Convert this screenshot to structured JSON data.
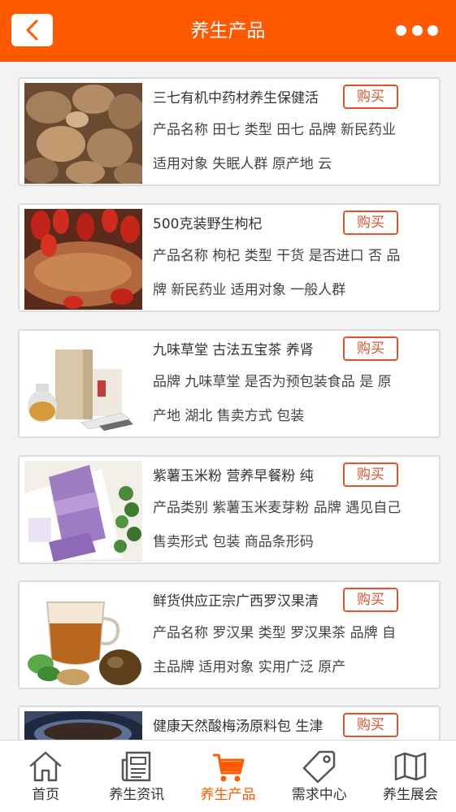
{
  "header": {
    "title": "养生产品"
  },
  "products": [
    {
      "name": "三七有机中药材养生保健活",
      "buy_label": "购买",
      "desc": "产品名称 田七 类型 田七 品牌 新民药业 适用对象 失眠人群 原产地 云",
      "image": "sanqi-root-photo"
    },
    {
      "name": "500克装野生枸杞",
      "buy_label": "购买",
      "desc": "产品名称 枸杞 类型 干货 是否进口 否 品牌 新民药业 适用对象 一般人群",
      "image": "goji-berry-photo"
    },
    {
      "name": "九味草堂 古法五宝茶 养肾",
      "buy_label": "购买",
      "desc": "品牌 九味草堂 是否为预包装食品 是 原产地 湖北 售卖方式 包装",
      "image": "tea-box-photo"
    },
    {
      "name": "紫薯玉米粉 营养早餐粉 纯",
      "buy_label": "购买",
      "desc": "产品类别 紫薯玉米麦芽粉 品牌 遇见自己 售卖形式 包装 商品条形码",
      "image": "purple-powder-package-photo"
    },
    {
      "name": "鲜货供应正宗广西罗汉果清",
      "buy_label": "购买",
      "desc": "产品名称 罗汉果 类型 罗汉果茶 品牌 自主品牌 适用对象 实用广泛 原产",
      "image": "luohan-tea-photo"
    },
    {
      "name": "健康天然酸梅汤原料包 生津",
      "buy_label": "购买",
      "desc": "",
      "image": "plum-soup-photo"
    }
  ],
  "tabbar": [
    {
      "label": "首页",
      "icon": "home-icon",
      "active": false
    },
    {
      "label": "养生资讯",
      "icon": "news-icon",
      "active": false
    },
    {
      "label": "养生产品",
      "icon": "cart-icon",
      "active": true
    },
    {
      "label": "需求中心",
      "icon": "tag-icon",
      "active": false
    },
    {
      "label": "养生展会",
      "icon": "map-icon",
      "active": false
    }
  ],
  "colors": {
    "accent": "#ff5a00",
    "buy_border": "#e0542b",
    "inactive_icon": "#555555"
  }
}
